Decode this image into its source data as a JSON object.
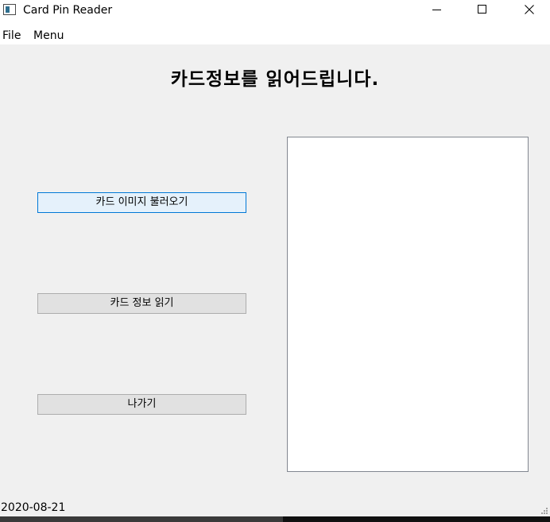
{
  "window": {
    "title": "Card Pin Reader",
    "icon": "app-window-icon",
    "controls": [
      "minimize-icon",
      "maximize-icon",
      "close-icon"
    ]
  },
  "menubar": {
    "items": [
      "File",
      "Menu"
    ]
  },
  "main": {
    "heading": "카드정보를 읽어드립니다.",
    "buttons": {
      "load_image": "카드 이미지 불러오기",
      "read_info": "카드 정보 읽기",
      "exit": "나가기"
    }
  },
  "status": {
    "date": "2020-08-21"
  },
  "colors": {
    "window_bg": "#f0f0f0",
    "focus_border": "#0078d7",
    "button_bg": "#e1e1e1",
    "preview_bg": "#ffffff"
  }
}
